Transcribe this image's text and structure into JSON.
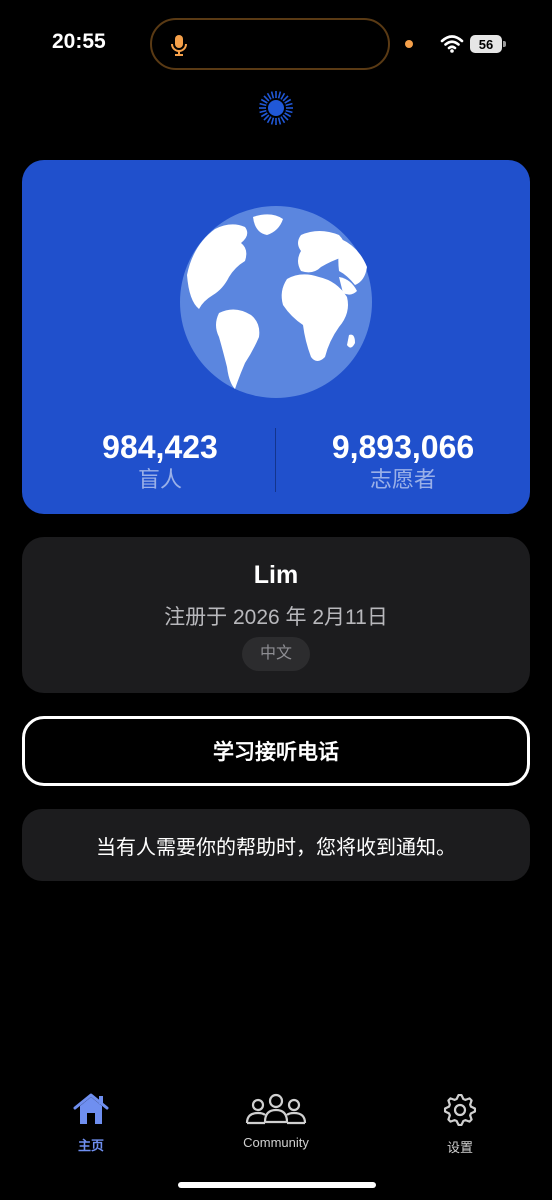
{
  "status_bar": {
    "time": "20:55",
    "battery": "56",
    "icons": [
      "microphone-icon",
      "wifi-icon",
      "battery-icon"
    ],
    "mic_color": "#f5a04a"
  },
  "stats": {
    "blind_count": "984,423",
    "blind_label": "盲人",
    "volunteer_count": "9,893,066",
    "volunteer_label": "志愿者",
    "card_color": "#2050cc"
  },
  "profile": {
    "name": "Lim",
    "registered": "注册于 2026 年 2月11日",
    "language": "中文"
  },
  "learn_button": {
    "label": "学习接听电话"
  },
  "notice": {
    "text": "当有人需要你的帮助时，您将收到通知。"
  },
  "tabs": [
    {
      "label": "主页",
      "icon": "home-icon",
      "active": true,
      "color": "#6f8ff0"
    },
    {
      "label": "Community",
      "icon": "people-icon",
      "active": false
    },
    {
      "label": "设置",
      "icon": "gear-icon",
      "active": false
    }
  ]
}
